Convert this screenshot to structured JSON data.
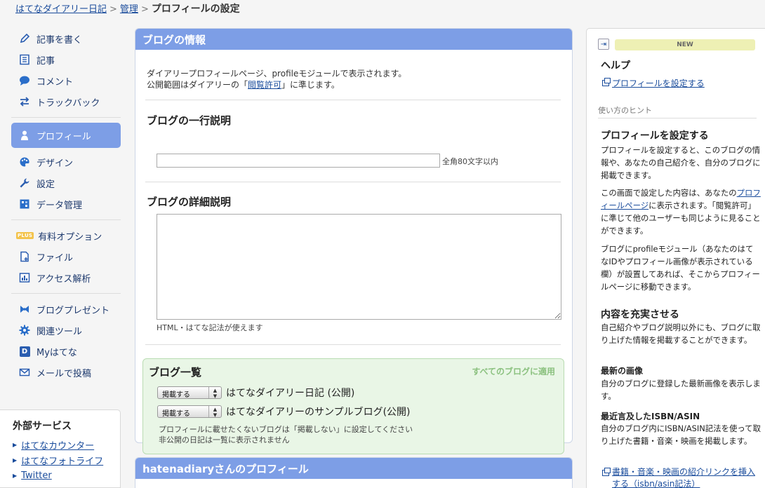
{
  "breadcrumb": {
    "home": "はてなダイアリー日記",
    "admin": "管理",
    "current": "プロフィールの設定"
  },
  "nav": {
    "write": "記事を書く",
    "articles": "記事",
    "comments": "コメント",
    "trackback": "トラックバック",
    "profile": "プロフィール",
    "design": "デザイン",
    "settings": "設定",
    "data": "データ管理",
    "plus_badge": "PLUS",
    "paid": "有料オプション",
    "files": "ファイル",
    "access": "アクセス解析",
    "present": "ブログプレゼント",
    "tools": "関連ツール",
    "myhatena_badge": "D",
    "myhatena": "Myはてな",
    "mailpost": "メールで投稿"
  },
  "external": {
    "title": "外部サービス",
    "links": [
      "はてなカウンター",
      "はてなフォトライフ",
      "Twitter"
    ]
  },
  "main": {
    "header": "ブログの情報",
    "desc_line1": "ダイアリープロフィールページ、profileモジュールで表示されます。",
    "desc_line2_pre": "公開範囲はダイアリーの「",
    "desc_link": "閲覧許可",
    "desc_line2_post": "」に準じます。",
    "oneline_title": "ブログの一行説明",
    "oneline_value": "",
    "oneline_hint": "全角80文字以内",
    "detail_title": "ブログの詳細説明",
    "detail_value": "",
    "detail_hint": "HTML・はてな記法が使えます"
  },
  "bloglist": {
    "title": "ブログ一覧",
    "apply_all": "すべてのブログに適用",
    "rows": [
      {
        "select": "掲載する",
        "name": "はてなダイアリー日記 (公開)"
      },
      {
        "select": "掲載する",
        "name": "はてなダイアリーのサンプルブログ(公開)"
      }
    ],
    "note1": "プロフィールに載せたくないブログは「掲載しない」に設定してください",
    "note2": "非公開の日記は一覧に表示されません"
  },
  "profile_panel": {
    "header": "hatenadiaryさんのプロフィール"
  },
  "help": {
    "collapse": "⇥",
    "new_badge": "NEW",
    "title": "ヘルプ",
    "link1": "プロフィールを設定する",
    "tips_label": "使い方のヒント",
    "h_setting": "プロフィールを設定する",
    "p1": "プロフィールを設定すると、このブログの情報や、あなたの自己紹介を、自分のブログに掲載できます。",
    "p2_pre": "この画面で設定した内容は、あなたの",
    "p2_link": "プロフィールページ",
    "p2_post": "に表示されます。「閲覧許可」に準じて他のユーザーも同じように見ることができます。",
    "p3": "ブログにprofileモジュール（あなたのはてなIDやプロフィール画像が表示されている欄）が設置してあれば、そこからプロフィールページに移動できます。",
    "h_enrich": "内容を充実させる",
    "p4": "自己紹介やブログ説明以外にも、ブログに取り上げた情報を掲載することができます。",
    "sub_image": "最新の画像",
    "p5": "自分のブログに登録した最新画像を表示します。",
    "sub_isbn": "最近言及したISBN/ASIN",
    "p6": "自分のブログ内にISBN/ASIN記法を使って取り上げた書籍・音楽・映画を掲載します。",
    "link2": "書籍・音楽・映画の紹介リンクを挿入する（isbn/asin記法）"
  },
  "colors": {
    "accent": "#7d9ee6",
    "link": "#1a4c9c",
    "bloglist_bg": "#e9f6e6",
    "new_badge_bg": "#eef0b4"
  }
}
